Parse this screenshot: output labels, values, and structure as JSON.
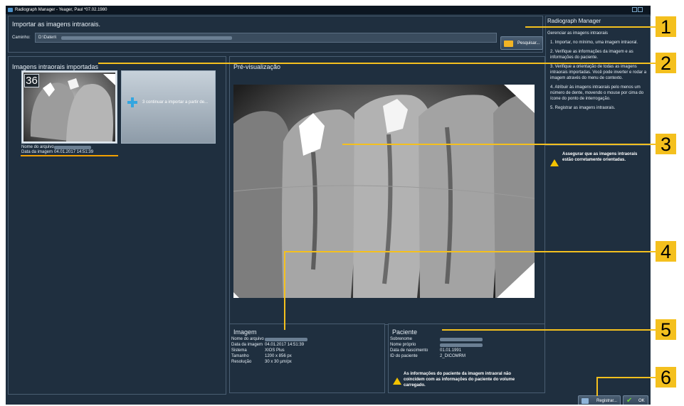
{
  "window": {
    "title": "Radiograph Manager - Yeager, Paul *07.02.1980"
  },
  "import_panel": {
    "title": "Importar as imagens intraorais.",
    "path_label": "Caminho:",
    "path_value": "D:\\Daten\\",
    "search_button": "Pesquisar..."
  },
  "imported_panel": {
    "title": "Imagens intraorais importadas",
    "thumbnail": {
      "tooth_number": "36",
      "filename_label": "Nome do arquivo",
      "date_label": "Data da imagem",
      "date_value": "04.01.2017 14:51:39"
    },
    "add_tile_label": "3 continuar a importar a partir de..."
  },
  "preview_panel": {
    "title": "Pré-visualização"
  },
  "image_panel": {
    "title": "Imagem",
    "rows": [
      {
        "label": "Nome do arquivo",
        "value": ""
      },
      {
        "label": "Data da imagem",
        "value": "04.01.2017 14:51:39"
      },
      {
        "label": "Sistema",
        "value": "XIOS Plus"
      },
      {
        "label": "Tamanho",
        "value": "1200 x 856 px"
      },
      {
        "label": "Resolução",
        "value": "30 x 30 µm/px"
      }
    ]
  },
  "patient_panel": {
    "title": "Paciente",
    "rows": [
      {
        "label": "Sobrenome",
        "value": ""
      },
      {
        "label": "Nome próprio",
        "value": ""
      },
      {
        "label": "Data de nascimento",
        "value": "01.01.1991"
      },
      {
        "label": "ID do paciente",
        "value": "2_DICOMRM"
      }
    ],
    "warning": "As informações do paciente da imagem intraoral não coincidem com as informações do paciente do volume carregado."
  },
  "sidebar": {
    "title": "Radiograph Manager",
    "subtitle": "Gerenciar as imagens intraorais",
    "steps": [
      "1. Importar, no mínimo, uma imagem intraoral.",
      "2. Verifique as informações da imagem e as informações do paciente.",
      "3. Verifique a orientação de todas as imagens intraorais importadas. Você pode inverter e rodar a imagem através do menu de contexto.",
      "4. Atribuir às imagens intraorais pelo menos um número de dente, movendo o mouse por cima do ícone do ponto de interrogação.",
      "5. Registrar as imagens intraorais."
    ],
    "warning": "Assegurar que as imagens intraorais estão corretamente orientadas."
  },
  "footer": {
    "register_button": "Registrar...",
    "ok_button": "OK"
  },
  "callouts": [
    "1",
    "2",
    "3",
    "4",
    "5",
    "6"
  ],
  "colors": {
    "background": "#1f2f3f",
    "callout": "#f4c01e",
    "selection_underline": "#f2a000"
  }
}
